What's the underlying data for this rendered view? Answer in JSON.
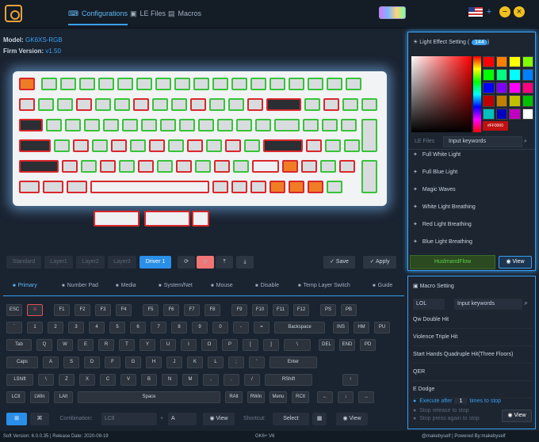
{
  "nav": {
    "tabs": [
      {
        "label": "Configurations",
        "icon": "keyboard-icon"
      },
      {
        "label": "LE Files",
        "icon": "file-icon"
      },
      {
        "label": "Macros",
        "icon": "document-icon"
      }
    ]
  },
  "info": {
    "model_label": "Model:",
    "model": "GK6XS-RGB",
    "firm_label": "Firm Version:",
    "firm": "v1.50"
  },
  "layers": {
    "items": [
      "Standard",
      "Layer1",
      "Layer2",
      "Layer3",
      "Driver 1"
    ],
    "save": "Save",
    "apply": "Apply"
  },
  "tabs": [
    "Primary",
    "Number Pad",
    "Media",
    "System/Net",
    "Mouse",
    "Disable",
    "Temp Layer Switch",
    "Guide"
  ],
  "keys": [
    [
      "ESC",
      "⊝",
      "F1",
      "F2",
      "F3",
      "F4",
      "F5",
      "F6",
      "F7",
      "F8",
      "F9",
      "F10",
      "F11",
      "F12",
      "PS",
      "PB"
    ],
    [
      "`",
      "1",
      "2",
      "3",
      "4",
      "5",
      "6",
      "7",
      "8",
      "9",
      "0",
      "-",
      "=",
      "Backspace",
      "INS",
      "HM",
      "PU"
    ],
    [
      "Tab",
      "Q",
      "W",
      "E",
      "R",
      "T",
      "Y",
      "U",
      "I",
      "O",
      "P",
      "[",
      "]",
      "\\",
      "DEL",
      "END",
      "PD"
    ],
    [
      "Caps",
      "A",
      "S",
      "D",
      "F",
      "G",
      "H",
      "J",
      "K",
      "L",
      ";",
      "'",
      "Enter"
    ],
    [
      "LShift",
      "\\",
      "Z",
      "X",
      "C",
      "V",
      "B",
      "N",
      "M",
      ",",
      ".",
      "/",
      "RShift",
      "↑"
    ],
    [
      "LCtl",
      "LWin",
      "LAlt",
      "Space",
      "RAlt",
      "RWin",
      "Menu",
      "RCtl",
      "←",
      "↓",
      "→"
    ]
  ],
  "bottom": {
    "combination_label": "Combination:",
    "combination": "LCtl",
    "plus": "+",
    "key": "A",
    "view": "View",
    "shortcut_label": "Shortcut:",
    "shortcut": "Select",
    "view2": "View"
  },
  "footer": {
    "soft": "Soft Version: 6.0.0.35 | Release Date: 2020-09-19",
    "center": "GK6+ V6",
    "right": "@makebyself | Powered By:makebyself"
  },
  "light": {
    "title": "Light Effect Setting",
    "count": "144",
    "hex": "#FF0000",
    "tabs": [
      "LE Files"
    ],
    "search_placeholder": "Input keywords",
    "effects": [
      "Full White Light",
      "Full Blue Light",
      "Magic Waves",
      "White Light Breathing",
      "Red Light Breathing",
      "Blue Light Breathing"
    ],
    "current": "HuslmandFlow",
    "view": "View"
  },
  "macro": {
    "title": "Macro Setting",
    "filter": "LOL",
    "search_placeholder": "Input keywords",
    "items": [
      "Qw Double Hit",
      "Violence Triple Hit",
      "Start Hands Quadruple Hit(Three Floors)",
      "QER",
      "E Dodge"
    ],
    "opt1a": "Execute after",
    "times": "1",
    "opt1b": "times to stop",
    "opt2": "Stop release to stop",
    "opt3": "Stop press again to stop",
    "view": "View"
  },
  "colors": {
    "accent": "#3a9ff0",
    "green": "#39c23a",
    "red": "#d8282c",
    "orange": "#f07d25"
  }
}
